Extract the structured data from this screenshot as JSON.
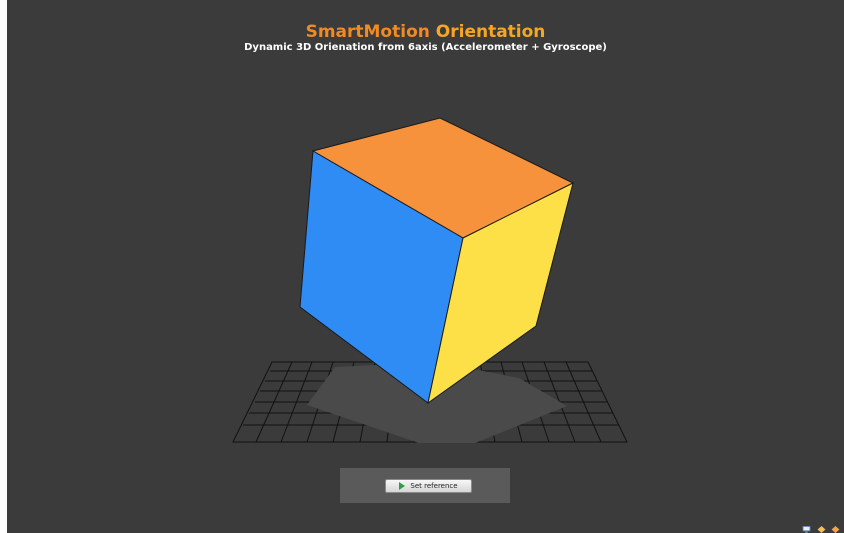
{
  "header": {
    "title_part1": "SmartMotion",
    "title_part2": "Orientation",
    "subtitle": "Dynamic 3D Orienation from 6axis (Accelerometer + Gyroscope)"
  },
  "controls": {
    "set_reference_label": "Set reference"
  },
  "colors": {
    "background": "#3b3b3b",
    "title_accent": "#f08a24",
    "cube_top": "#f7923c",
    "cube_left": "#2f8cf5",
    "cube_right": "#fde047",
    "grid": "#111111",
    "shadow": "#4a4a4a"
  },
  "icons": {
    "play": "play-icon",
    "tray": [
      "monitor-icon",
      "diamond-icon",
      "diamond-icon"
    ]
  }
}
